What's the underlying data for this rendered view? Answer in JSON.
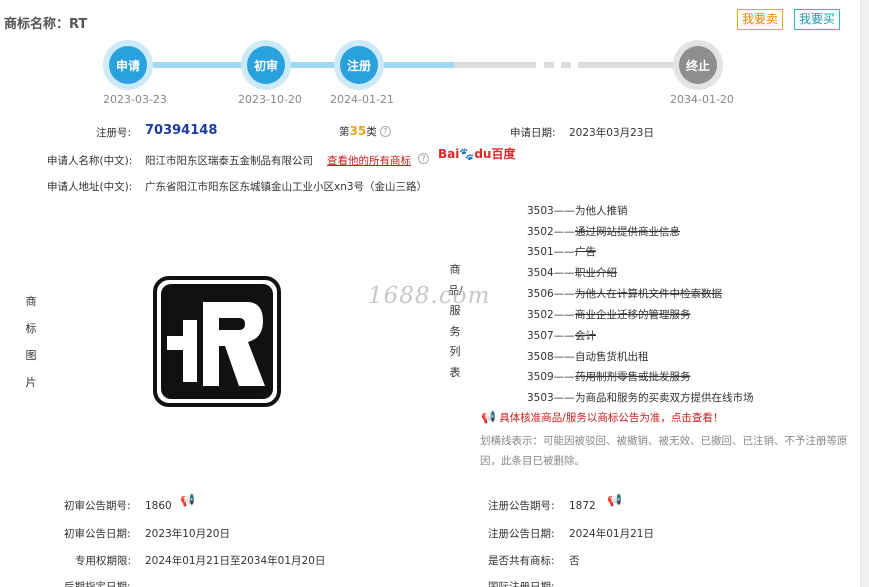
{
  "header": {
    "title": "商标名称：RT",
    "sell_label": "我要卖",
    "buy_label": "我要买"
  },
  "timeline": {
    "steps": [
      {
        "label": "申请",
        "date": "2023-03-23",
        "state": "done"
      },
      {
        "label": "初审",
        "date": "2023-10-20",
        "state": "done"
      },
      {
        "label": "注册",
        "date": "2024-01-21",
        "state": "done"
      },
      {
        "label": "终止",
        "date": "2034-01-20",
        "state": "pending"
      }
    ]
  },
  "info": {
    "reg_no_label": "注册号:",
    "reg_no": "70394148",
    "class_prefix": "第",
    "class_num": "35",
    "class_suffix": "类",
    "apply_date_label": "申请日期:",
    "apply_date": "2023年03月23日",
    "applicant_label": "申请人名称(中文):",
    "applicant": "阳江市阳东区瑞泰五金制品有限公司",
    "view_all": "查看他的所有商标",
    "baidu_a": "Bai",
    "baidu_b": "du",
    "baidu_c": "百度",
    "address_label": "申请人地址(中文):",
    "address": "广东省阳江市阳东区东城镇金山工业小区xn3号（金山三路）"
  },
  "image_label": "商标图片",
  "goods_label": "商品/服务列表",
  "watermark": "1688.com",
  "goods": [
    {
      "code": "3503——",
      "name": "为他人推销",
      "struck": false
    },
    {
      "code": "3502——",
      "name": "通过网站提供商业信息",
      "struck": true
    },
    {
      "code": "3501——",
      "name": "广告",
      "struck": true
    },
    {
      "code": "3504——",
      "name": "职业介绍",
      "struck": true
    },
    {
      "code": "3506——",
      "name": "为他人在计算机文件中检索数据",
      "struck": true
    },
    {
      "code": "3502——",
      "name": "商业企业迁移的管理服务",
      "struck": true
    },
    {
      "code": "3507——",
      "name": "会计",
      "struck": true
    },
    {
      "code": "3508——",
      "name": "自动售货机出租",
      "struck": false
    },
    {
      "code": "3509——",
      "name": "药用制剂零售或批发服务",
      "struck": true
    },
    {
      "code": "3503——",
      "name": "为商品和服务的买卖双方提供在线市场",
      "struck": false
    }
  ],
  "notice": "具体核准商品/服务以商标公告为准，点击查看！",
  "note": "划横线表示：可能因被驳回、被撤销、被无效、已撤回、已注销、不予注册等原因，此条目已被删除。",
  "footer": {
    "prelim_no_label": "初审公告期号:",
    "prelim_no": "1860",
    "reg_pub_no_label": "注册公告期号:",
    "reg_pub_no": "1872",
    "prelim_date_label": "初审公告日期:",
    "prelim_date": "2023年10月20日",
    "reg_pub_date_label": "注册公告日期:",
    "reg_pub_date": "2024年01月21日",
    "exclusive_label": "专用权期限:",
    "exclusive": "2024年01月21日至2034年01月20日",
    "shared_label": "是否共有商标:",
    "shared": "否",
    "late_label": "后期指定日期:",
    "intl_label": "国际注册日期:"
  },
  "colors": {
    "blue": "#29a1dc",
    "gray": "#8e8e8e",
    "orange": "#f0a520",
    "red": "#c81d1d",
    "navy": "#1c3d9b"
  },
  "icons": {
    "help": "question-circle-icon",
    "horn": "megaphone-icon"
  }
}
